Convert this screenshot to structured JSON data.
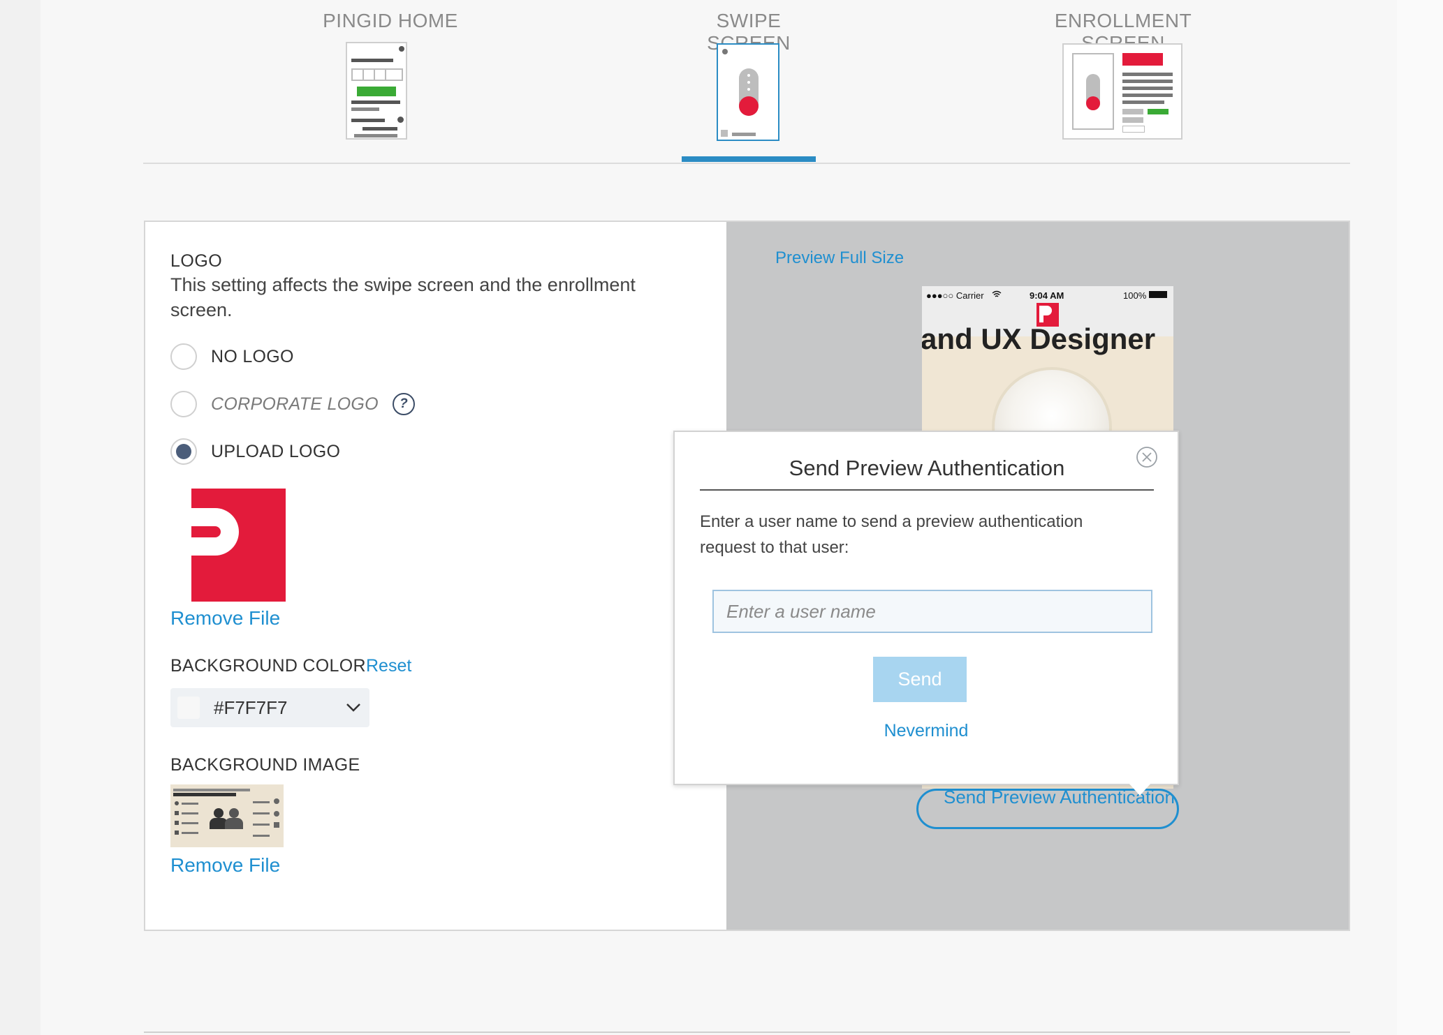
{
  "tabs": [
    {
      "label": "PINGID HOME",
      "active": false
    },
    {
      "label": "SWIPE SCREEN",
      "active": true
    },
    {
      "label": "ENROLLMENT SCREEN",
      "active": false
    }
  ],
  "colors": {
    "accent": "#2b8cc4",
    "link": "#1f8fd0",
    "brand_red": "#e31b3b",
    "radio_checked": "#4b5d7a",
    "preview_bg": "#c6c7c8"
  },
  "settings": {
    "logo_heading": "LOGO",
    "logo_description": "This setting affects the swipe screen and the enrollment screen.",
    "options": [
      {
        "label": "NO LOGO",
        "checked": false
      },
      {
        "label": "CORPORATE LOGO",
        "checked": false,
        "help_icon": "question-icon"
      },
      {
        "label": "UPLOAD LOGO",
        "checked": true
      }
    ],
    "remove_file": "Remove File",
    "background_color_label": "BACKGROUND COLOR",
    "reset_label": "Reset",
    "background_color_value": "#F7F7F7",
    "background_image_label": "BACKGROUND IMAGE",
    "remove_file_2": "Remove File"
  },
  "preview": {
    "full_size_link": "Preview Full Size",
    "status_carrier": "●●●○○ Carrier",
    "status_time": "9:04 AM",
    "status_battery": "100%",
    "headline": "and UX Designer",
    "send_preview_button": "Send Preview Authentication"
  },
  "modal": {
    "title": "Send Preview Authentication",
    "text": "Enter a user name to send a preview authentication request to that user:",
    "input_value": "",
    "input_placeholder": "Enter a user name",
    "send_label": "Send",
    "nevermind_label": "Nevermind"
  }
}
